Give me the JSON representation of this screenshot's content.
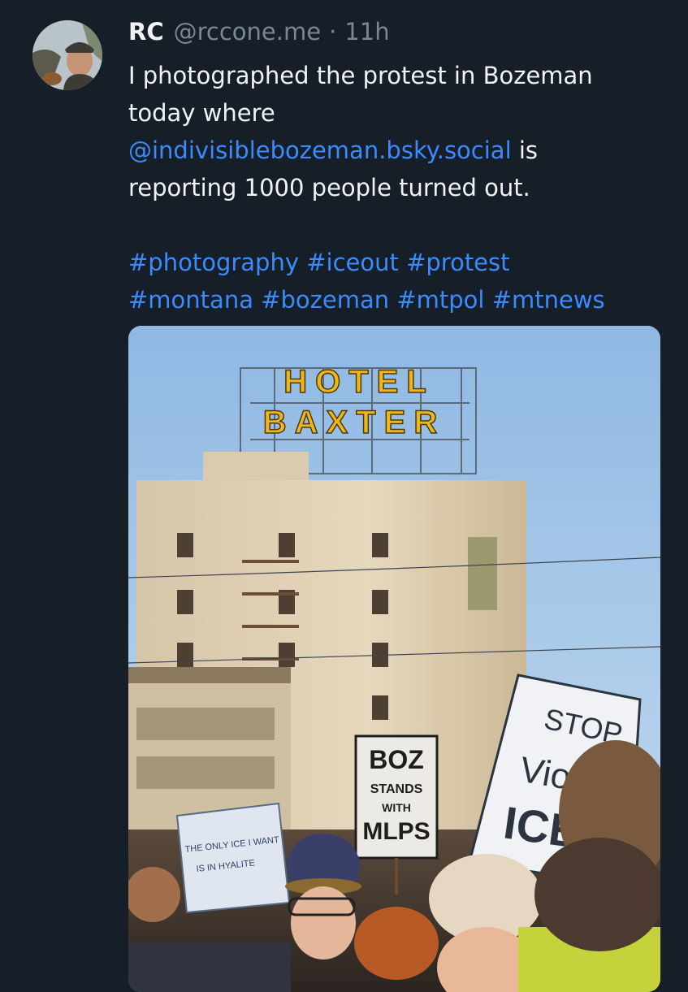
{
  "post": {
    "author_name": "RC",
    "handle": "@rccone.me",
    "separator": "·",
    "time": "11h",
    "text_line_1": "I photographed the protest in Bozeman",
    "text_line_2": "today where",
    "mention": "@indivisiblebozeman.bsky.social",
    "text_after_mention": " is",
    "text_line_4": "reporting 1000 people turned out.",
    "hashtags": [
      "#photography",
      "#iceout",
      "#protest",
      "#montana",
      "#bozeman",
      "#mtpol",
      "#mtnews"
    ]
  },
  "photo": {
    "sign_hotel_line_1": "HOTEL",
    "sign_hotel_line_2": "BAXTER",
    "sign_boz_1": "BOZ",
    "sign_boz_2": "STANDS",
    "sign_boz_3": "WITH",
    "sign_boz_4": "MLPS",
    "sign_ice_1": "THE ONLY ICE I WANT",
    "sign_ice_2": "IS IN HYALITE",
    "sign_stop": "STOP",
    "sign_violence": "Violenc",
    "sign_ice_big": "ICE"
  },
  "colors": {
    "background": "#161e27",
    "link": "#3b8bff",
    "muted": "#7b8794",
    "sign_letters": "#f0b51a"
  }
}
